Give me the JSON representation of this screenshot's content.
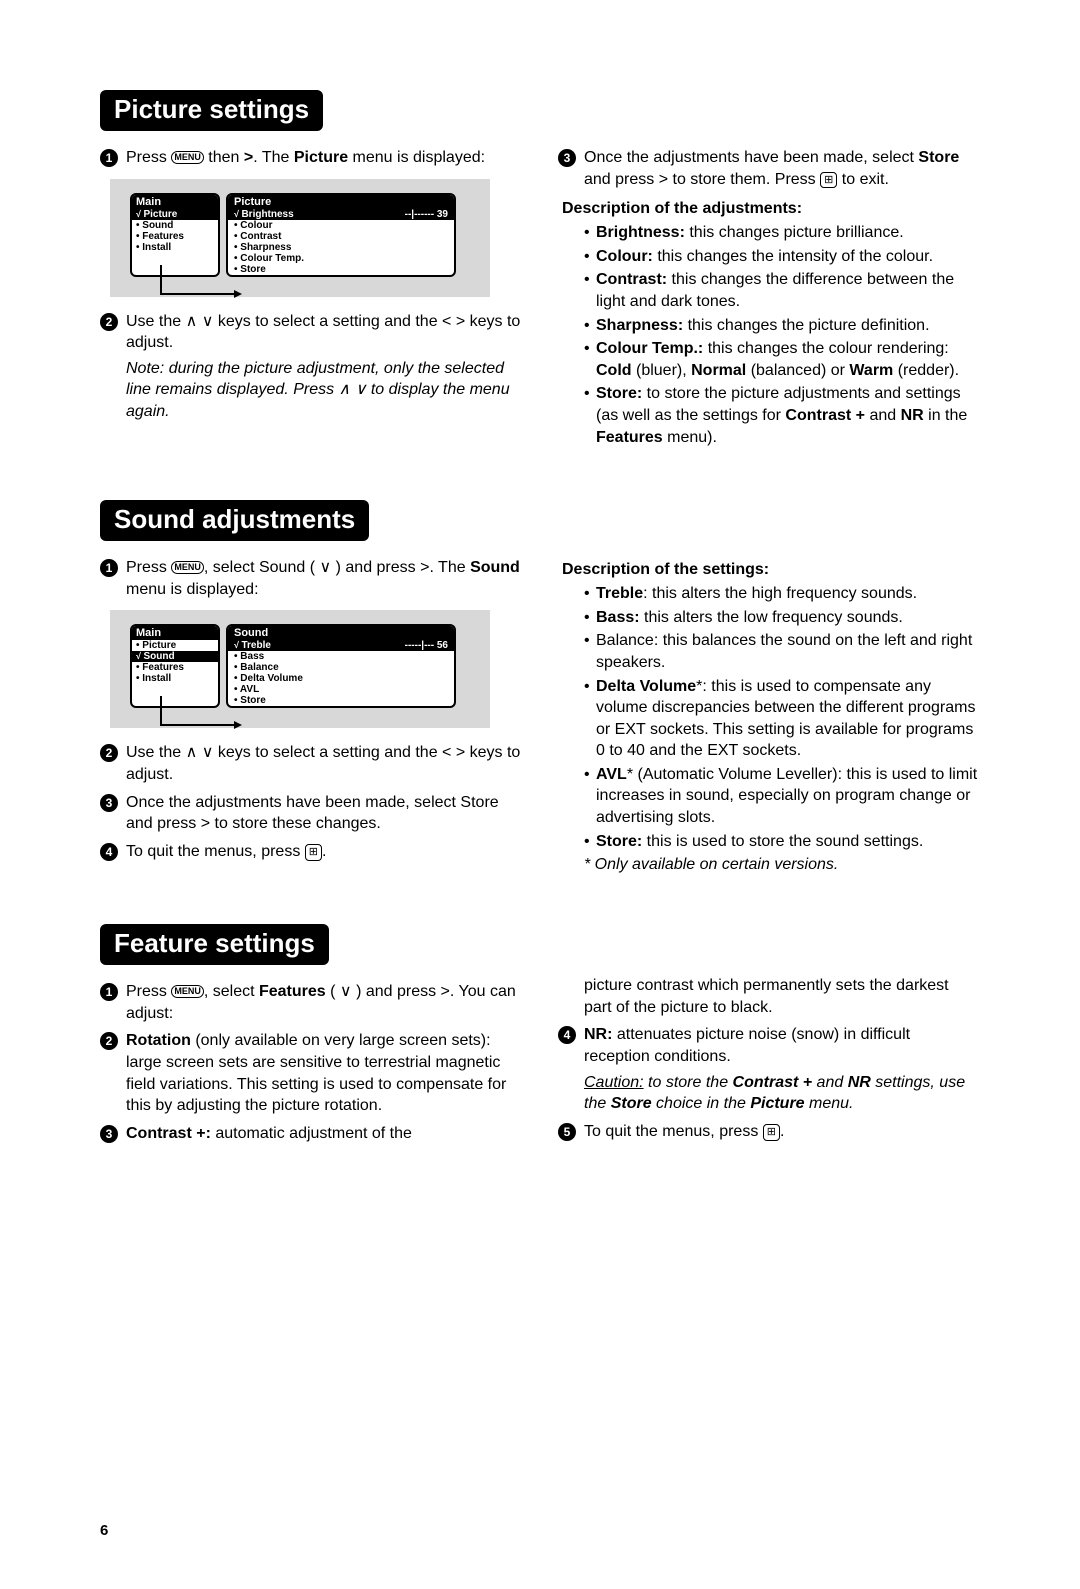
{
  "page_number": "6",
  "sections": {
    "picture": {
      "title": "Picture settings",
      "step1_a": "Press ",
      "step1_menu": "MENU",
      "step1_b": " then ",
      "step1_c": ". The ",
      "step1_bold": "Picture",
      "step1_d": " menu is displayed:",
      "step2": "Use the ∧ ∨ keys to select a setting and the < > keys to adjust.",
      "note": "Note: during the picture adjustment, only the selected line remains displayed. Press ∧ ∨ to display the menu again.",
      "step3_a": "Once the adjustments have been made, select ",
      "step3_b": "Store",
      "step3_c": " and press > to store them. Press ",
      "step3_d": " to exit.",
      "desc_head": "Description of the adjustments:",
      "desc": {
        "brightness_l": "Brightness:",
        "brightness_t": " this changes picture brilliance.",
        "colour_l": "Colour:",
        "colour_t": " this changes the intensity of the colour.",
        "contrast_l": "Contrast:",
        "contrast_t": " this changes the difference between the light and dark tones.",
        "sharpness_l": "Sharpness:",
        "sharpness_t": " this changes the picture definition.",
        "ct_l": "Colour Temp.:",
        "ct_t1": " this changes the colour rendering: ",
        "ct_cold": "Cold",
        "ct_t2": " (bluer), ",
        "ct_norm": "Normal",
        "ct_t3": " (balanced) or ",
        "ct_warm": "Warm",
        "ct_t4": " (redder).",
        "store_l": "Store:",
        "store_t1": " to store the picture adjustments and settings (as well as the settings for ",
        "store_b1": "Contrast +",
        "store_t2": " and ",
        "store_b2": "NR",
        "store_t3": " in the ",
        "store_b3": "Features",
        "store_t4": " menu)."
      },
      "osd": {
        "main_head": "Main",
        "main_items": [
          "Picture",
          "Sound",
          "Features",
          "Install"
        ],
        "main_selected_index": 0,
        "sub_head": "Picture",
        "sel_label": "Brightness",
        "sel_bar": "--|------",
        "sel_val": "39",
        "sub_items": [
          "Colour",
          "Contrast",
          "Sharpness",
          "Colour Temp.",
          "Store"
        ]
      }
    },
    "sound": {
      "title": "Sound adjustments",
      "step1_a": "Press ",
      "step1_b": ", select Sound ( ∨ ) and press >. The ",
      "step1_bold": "Sound",
      "step1_c": " menu is displayed:",
      "step2": "Use the ∧ ∨ keys to select a setting and the < > keys to adjust.",
      "step3": "Once the adjustments have been made, select Store and press > to store these changes.",
      "step4_a": "To quit the menus, press ",
      "desc_head": "Description of the settings:",
      "desc": {
        "treble_l": "Treble",
        "treble_t": ": this alters the high frequency sounds.",
        "bass_l": "Bass:",
        "bass_t": " this alters the low frequency sounds.",
        "balance_t": "Balance: this balances the sound on the left and right speakers.",
        "dv_l": "Delta Volume",
        "dv_t": "*: this is used to compensate any volume discrepancies between the different programs or EXT sockets. This setting is available for programs 0 to 40 and the EXT sockets.",
        "avl_l": "AVL",
        "avl_t": "* (Automatic Volume Leveller): this is used to limit increases in sound, especially on program change or advertising slots.",
        "store_l": "Store:",
        "store_t": " this is used to store the sound settings.",
        "foot": "* Only available on certain versions."
      },
      "osd": {
        "main_head": "Main",
        "main_items": [
          "Picture",
          "Sound",
          "Features",
          "Install"
        ],
        "main_selected_index": 1,
        "sub_head": "Sound",
        "sel_label": "Treble",
        "sel_bar": "-----|---",
        "sel_val": "56",
        "sub_items": [
          "Bass",
          "Balance",
          "Delta Volume",
          "AVL",
          "Store"
        ]
      }
    },
    "feature": {
      "title": "Feature settings",
      "step1_a": "Press ",
      "step1_b": ", select ",
      "step1_bold": "Features",
      "step1_c": " ( ∨ ) and press >. You can adjust:",
      "step2_l": "Rotation",
      "step2_t": " (only available on very large screen sets): large screen sets are sensitive to terrestrial magnetic field variations. This setting is used to compensate for this by adjusting the picture rotation.",
      "step3_l": "Contrast +:",
      "step3_t": " automatic adjustment of the",
      "col2_top": "picture contrast which permanently sets the darkest part of the picture to black.",
      "step4_l": "NR:",
      "step4_t": " attenuates picture noise (snow) in difficult reception conditions.",
      "caution_a": "Caution:",
      "caution_b": " to store the ",
      "caution_c": "Contrast +",
      "caution_d": " and ",
      "caution_e": "NR",
      "caution_f": " settings, use the ",
      "caution_g": "Store",
      "caution_h": " choice in the ",
      "caution_i": "Picture",
      "caution_j": " menu.",
      "step5_a": "To quit the menus, press "
    }
  }
}
